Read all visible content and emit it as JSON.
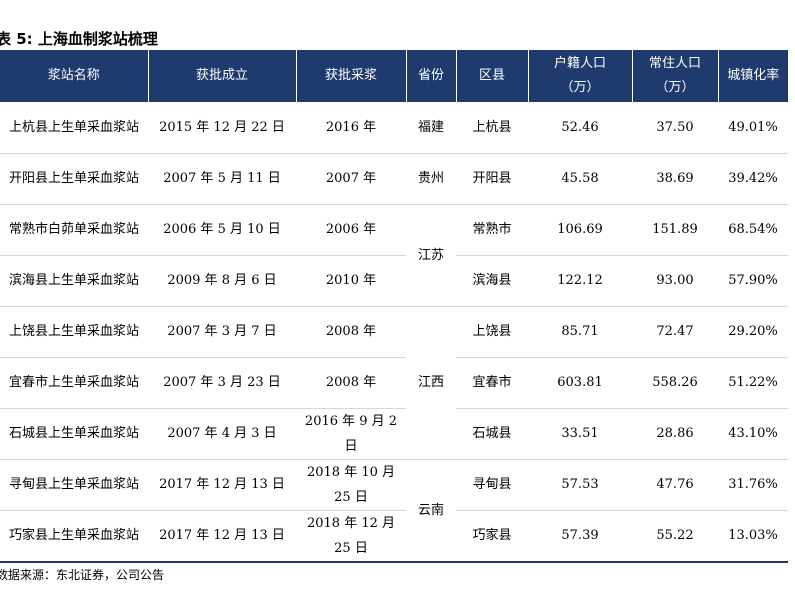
{
  "title": "表 5: 上海血制浆站梳理",
  "headers": [
    {
      "line1": "浆站名称",
      "line2": ""
    },
    {
      "line1": "获批成立",
      "line2": ""
    },
    {
      "line1": "获批采浆",
      "line2": ""
    },
    {
      "line1": "省份",
      "line2": ""
    },
    {
      "line1": "区县",
      "line2": ""
    },
    {
      "line1": "户籍人口",
      "line2": "（万）"
    },
    {
      "line1": "常住人口",
      "line2": "（万）"
    },
    {
      "line1": "城镇化率",
      "line2": ""
    }
  ],
  "rows": [
    {
      "name": "上杭县上生单采血浆站",
      "approved": "2015 年 12 月 22 日",
      "collect": "2016 年",
      "province": "福建",
      "county": "上杭县",
      "registered": "52.46",
      "resident": "37.50",
      "urban": "49.01%"
    },
    {
      "name": "开阳县上生单采血浆站",
      "approved": "2007 年 5 月 11 日",
      "collect": "2007 年",
      "province": "贵州",
      "county": "开阳县",
      "registered": "45.58",
      "resident": "38.69",
      "urban": "39.42%"
    },
    {
      "name": "常熟市白茆单采血浆站",
      "approved": "2006 年 5 月 10 日",
      "collect": "2006 年",
      "province": "江苏",
      "county": "常熟市",
      "registered": "106.69",
      "resident": "151.89",
      "urban": "68.54%"
    },
    {
      "name": "滨海县上生单采血浆站",
      "approved": "2009 年 8 月 6 日",
      "collect": "2010 年",
      "province": "",
      "county": "滨海县",
      "registered": "122.12",
      "resident": "93.00",
      "urban": "57.90%"
    },
    {
      "name": "上饶县上生单采血浆站",
      "approved": "2007 年 3 月 7 日",
      "collect": "2008 年",
      "province": "江西",
      "county": "上饶县",
      "registered": "85.71",
      "resident": "72.47",
      "urban": "29.20%"
    },
    {
      "name": "宜春市上生单采血浆站",
      "approved": "2007 年 3 月 23 日",
      "collect": "2008 年",
      "province": "",
      "county": "宜春市",
      "registered": "603.81",
      "resident": "558.26",
      "urban": "51.22%"
    },
    {
      "name": "石城县上生单采血浆站",
      "approved": "2007 年 4 月 3 日",
      "collect": "2016 年 9 月 2 日",
      "province": "",
      "county": "石城县",
      "registered": "33.51",
      "resident": "28.86",
      "urban": "43.10%"
    },
    {
      "name": "寻甸县上生单采血浆站",
      "approved": "2017 年 12 月 13 日",
      "collect": "2018 年 10 月 25 日",
      "province": "云南",
      "county": "寻甸县",
      "registered": "57.53",
      "resident": "47.76",
      "urban": "31.76%"
    },
    {
      "name": "巧家县上生单采血浆站",
      "approved": "2017 年 12 月 13 日",
      "collect": "2018 年 12 月 25 日",
      "province": "",
      "county": "巧家县",
      "registered": "57.39",
      "resident": "55.22",
      "urban": "13.03%"
    }
  ],
  "source": "数据来源：东北证券，公司公告"
}
